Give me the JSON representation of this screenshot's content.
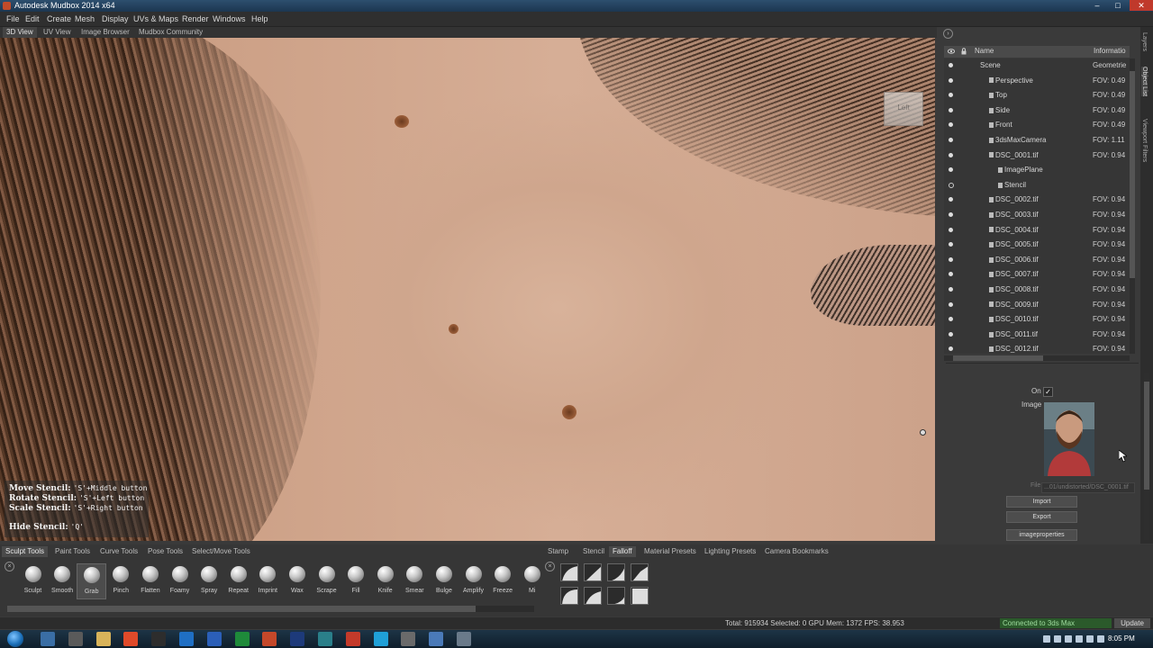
{
  "window": {
    "title": "Autodesk Mudbox 2014 x64",
    "controls": [
      "–",
      "□",
      "✕"
    ]
  },
  "menu": [
    "File",
    "Edit",
    "Create",
    "Mesh",
    "Display",
    "UVs & Maps",
    "Render",
    "Windows",
    "Help"
  ],
  "view_tabs": [
    "3D View",
    "UV View",
    "Image Browser",
    "Mudbox Community"
  ],
  "active_view_tab": "3D View",
  "viewport": {
    "cube_label": "Left",
    "stencil_help": [
      {
        "action": "Move Stencil:",
        "keys": "'S'+Middle button"
      },
      {
        "action": "Rotate Stencil:",
        "keys": "'S'+Left button"
      },
      {
        "action": "Scale Stencil:",
        "keys": "'S'+Right button"
      },
      {
        "action": "Hide Stencil:",
        "keys": "'Q'"
      }
    ]
  },
  "right_tabs": [
    "Layers",
    "Object List",
    "Viewport Filters"
  ],
  "outliner": {
    "columns": [
      "Name",
      "Informatio"
    ],
    "rows": [
      {
        "name": "Scene",
        "info": "Geometrie",
        "indent": 0,
        "eye": "filled"
      },
      {
        "name": "Perspective",
        "info": "FOV: 0.49",
        "indent": 1,
        "eye": "filled"
      },
      {
        "name": "Top",
        "info": "FOV: 0.49",
        "indent": 1,
        "eye": "filled"
      },
      {
        "name": "Side",
        "info": "FOV: 0.49",
        "indent": 1,
        "eye": "filled"
      },
      {
        "name": "Front",
        "info": "FOV: 0.49",
        "indent": 1,
        "eye": "filled"
      },
      {
        "name": "3dsMaxCamera",
        "info": "FOV: 1.11",
        "indent": 1,
        "eye": "filled"
      },
      {
        "name": "DSC_0001.tif",
        "info": "FOV: 0.94",
        "indent": 1,
        "eye": "filled"
      },
      {
        "name": "ImagePlane",
        "info": "",
        "indent": 2,
        "eye": "filled"
      },
      {
        "name": "Stencil",
        "info": "",
        "indent": 2,
        "eye": "hollow"
      },
      {
        "name": "DSC_0002.tif",
        "info": "FOV: 0.94",
        "indent": 1,
        "eye": "filled"
      },
      {
        "name": "DSC_0003.tif",
        "info": "FOV: 0.94",
        "indent": 1,
        "eye": "filled"
      },
      {
        "name": "DSC_0004.tif",
        "info": "FOV: 0.94",
        "indent": 1,
        "eye": "filled"
      },
      {
        "name": "DSC_0005.tif",
        "info": "FOV: 0.94",
        "indent": 1,
        "eye": "filled"
      },
      {
        "name": "DSC_0006.tif",
        "info": "FOV: 0.94",
        "indent": 1,
        "eye": "filled"
      },
      {
        "name": "DSC_0007.tif",
        "info": "FOV: 0.94",
        "indent": 1,
        "eye": "filled"
      },
      {
        "name": "DSC_0008.tif",
        "info": "FOV: 0.94",
        "indent": 1,
        "eye": "filled"
      },
      {
        "name": "DSC_0009.tif",
        "info": "FOV: 0.94",
        "indent": 1,
        "eye": "filled"
      },
      {
        "name": "DSC_0010.tif",
        "info": "FOV: 0.94",
        "indent": 1,
        "eye": "filled"
      },
      {
        "name": "DSC_0011.tif",
        "info": "FOV: 0.94",
        "indent": 1,
        "eye": "filled"
      },
      {
        "name": "DSC_0012.tif",
        "info": "FOV: 0.94",
        "indent": 1,
        "eye": "filled"
      }
    ]
  },
  "properties": {
    "on_label": "On",
    "on_checked": "✓",
    "image_label": "Image",
    "file_label": "File",
    "file_value": "...01/undistorted/DSC_0001.tif",
    "import_label": "Import",
    "export_label": "Export",
    "image_properties_label": "imageproperties"
  },
  "tool_tabs_left": [
    "Sculpt Tools",
    "Paint Tools",
    "Curve Tools",
    "Pose Tools",
    "Select/Move Tools"
  ],
  "active_tool_tab": "Sculpt Tools",
  "tool_tabs_right": [
    "Stamp",
    "Stencil",
    "Falloff",
    "Material Presets",
    "Lighting Presets",
    "Camera Bookmarks"
  ],
  "active_right_tab": "Falloff",
  "tools": [
    "Sculpt",
    "Smooth",
    "Grab",
    "Pinch",
    "Flatten",
    "Foamy",
    "Spray",
    "Repeat",
    "Imprint",
    "Wax",
    "Scrape",
    "Fill",
    "Knife",
    "Smear",
    "Bulge",
    "Amplify",
    "Freeze",
    "Mi"
  ],
  "active_tool": "Grab",
  "status": {
    "stats": "Total: 915934  Selected: 0  GPU Mem: 1372  FPS: 38.953",
    "connection": "Connected to 3ds Max",
    "update_label": "Update"
  },
  "taskbar": {
    "clock": "8:05 PM",
    "icon_colors": [
      "#3a6ea5",
      "#5a5a5a",
      "#d8b35a",
      "#e04a2a",
      "#2d2d2d",
      "#1f6fc4",
      "#2b5fb8",
      "#1e8a3a",
      "#c4482a",
      "#1d3a7a",
      "#2a7f8a",
      "#c43a2a",
      "#1fa0d8",
      "#6a6a6a",
      "#4a7ab8",
      "#6a7a8a"
    ]
  }
}
